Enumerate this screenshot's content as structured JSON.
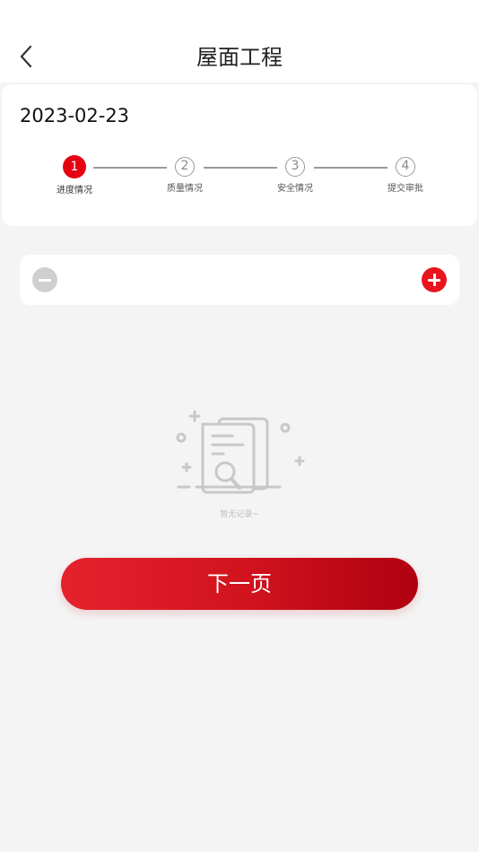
{
  "header": {
    "title": "屋面工程"
  },
  "record": {
    "date": "2023-02-23"
  },
  "steps": [
    {
      "number": "1",
      "label": "进度情况",
      "active": true
    },
    {
      "number": "2",
      "label": "质量情况",
      "active": false
    },
    {
      "number": "3",
      "label": "安全情况",
      "active": false
    },
    {
      "number": "4",
      "label": "提交审批",
      "active": false
    }
  ],
  "empty_state": {
    "text": "暂无记录~",
    "icon": "empty-document-search-icon"
  },
  "actions": {
    "next_label": "下一页"
  },
  "colors": {
    "accent": "#e60012",
    "button_gradient_start": "#e3222c",
    "button_gradient_end": "#b0000f",
    "background": "#f4f4f4"
  }
}
